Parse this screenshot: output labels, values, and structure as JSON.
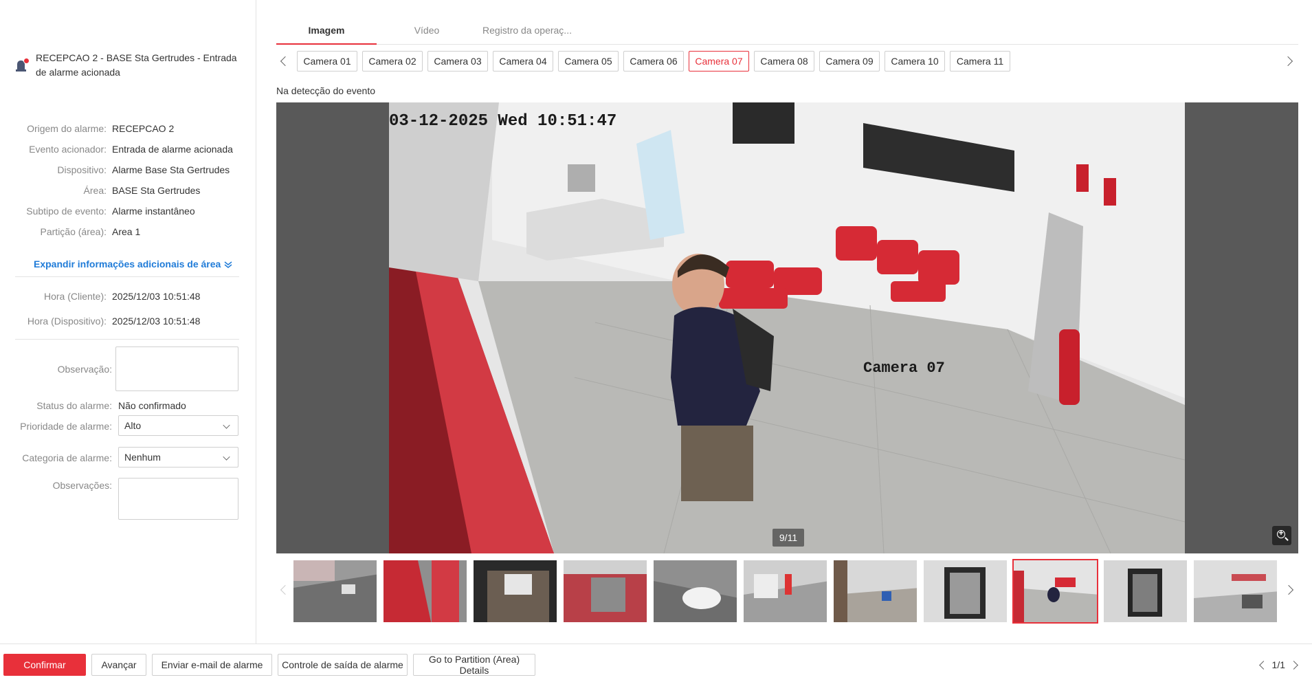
{
  "alarm": {
    "title": "RECEPCAO 2 - BASE Sta Gertrudes - Entrada de alarme acionada",
    "icon": "alarm-siren-icon"
  },
  "details": [
    {
      "label": "Origem do alarme:",
      "value": "RECEPCAO 2"
    },
    {
      "label": "Evento acionador:",
      "value": "Entrada de alarme acionada"
    },
    {
      "label": "Dispositivo:",
      "value": "Alarme Base Sta Gertrudes"
    },
    {
      "label": "Área:",
      "value": "BASE Sta Gertrudes"
    },
    {
      "label": "Subtipo de evento:",
      "value": "Alarme instantâneo"
    },
    {
      "label": "Partição (área):",
      "value": "Area 1"
    }
  ],
  "expand_link": "Expandir informações adicionais de área",
  "times": [
    {
      "label": "Hora (Cliente):",
      "value": "2025/12/03 10:51:48"
    },
    {
      "label": "Hora (Dispositivo):",
      "value": "2025/12/03 10:51:48"
    }
  ],
  "form": {
    "observation_label": "Observação:",
    "status_label": "Status do alarme:",
    "status_value": "Não confirmado",
    "priority_label": "Prioridade de alarme:",
    "priority_value": "Alto",
    "category_label": "Categoria de alarme:",
    "category_value": "Nenhum",
    "notes_label": "Observações:"
  },
  "tabs": [
    {
      "label": "Imagem",
      "active": true
    },
    {
      "label": "Vídeo",
      "active": false
    },
    {
      "label": "Registro da operaç...",
      "active": false
    }
  ],
  "cameras": [
    "Camera 01",
    "Camera 02",
    "Camera 03",
    "Camera 04",
    "Camera 05",
    "Camera 06",
    "Camera 07",
    "Camera 08",
    "Camera 09",
    "Camera 10",
    "Camera 11"
  ],
  "active_camera": "Camera 07",
  "event_caption": "Na detecção do evento",
  "image": {
    "osd_timestamp": "03-12-2025 Wed 10:51:47",
    "osd_camera": "Camera 07",
    "counter": "9/11"
  },
  "thumbnails": {
    "count": 11,
    "active_index": 8
  },
  "buttons": {
    "confirm": "Confirmar",
    "advance": "Avançar",
    "email": "Enviar e-mail de alarme",
    "output": "Controle de saída de alarme",
    "partition": "Go to Partition (Area) Details"
  },
  "pager": "1/1",
  "colors": {
    "accent": "#e8303a",
    "link": "#1f7bd8"
  }
}
